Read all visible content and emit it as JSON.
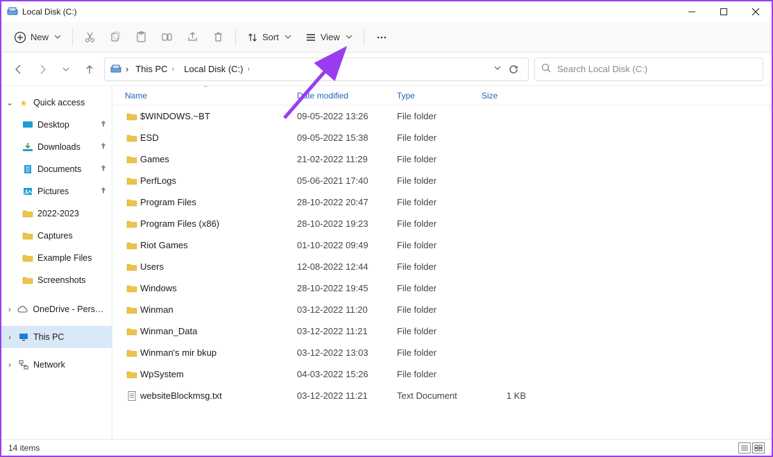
{
  "window": {
    "title": "Local Disk (C:)"
  },
  "toolbar": {
    "new_label": "New",
    "sort_label": "Sort",
    "view_label": "View"
  },
  "breadcrumb": {
    "items": [
      "This PC",
      "Local Disk (C:)"
    ]
  },
  "search": {
    "placeholder": "Search Local Disk (C:)"
  },
  "sidebar": {
    "quick_access": "Quick access",
    "quick_items": [
      {
        "label": "Desktop",
        "pinned": true,
        "icon": "desktop"
      },
      {
        "label": "Downloads",
        "pinned": true,
        "icon": "download"
      },
      {
        "label": "Documents",
        "pinned": true,
        "icon": "document"
      },
      {
        "label": "Pictures",
        "pinned": true,
        "icon": "pictures"
      },
      {
        "label": "2022-2023",
        "pinned": false,
        "icon": "folder"
      },
      {
        "label": "Captures",
        "pinned": false,
        "icon": "folder"
      },
      {
        "label": "Example Files",
        "pinned": false,
        "icon": "folder"
      },
      {
        "label": "Screenshots",
        "pinned": false,
        "icon": "folder"
      }
    ],
    "onedrive": "OneDrive - Personal",
    "this_pc": "This PC",
    "network": "Network"
  },
  "columns": {
    "name": "Name",
    "date": "Date modified",
    "type": "Type",
    "size": "Size"
  },
  "files": [
    {
      "name": "$WINDOWS.~BT",
      "date": "09-05-2022 13:26",
      "type": "File folder",
      "size": "",
      "icon": "folder"
    },
    {
      "name": "ESD",
      "date": "09-05-2022 15:38",
      "type": "File folder",
      "size": "",
      "icon": "folder"
    },
    {
      "name": "Games",
      "date": "21-02-2022 11:29",
      "type": "File folder",
      "size": "",
      "icon": "folder"
    },
    {
      "name": "PerfLogs",
      "date": "05-06-2021 17:40",
      "type": "File folder",
      "size": "",
      "icon": "folder"
    },
    {
      "name": "Program Files",
      "date": "28-10-2022 20:47",
      "type": "File folder",
      "size": "",
      "icon": "folder"
    },
    {
      "name": "Program Files (x86)",
      "date": "28-10-2022 19:23",
      "type": "File folder",
      "size": "",
      "icon": "folder"
    },
    {
      "name": "Riot Games",
      "date": "01-10-2022 09:49",
      "type": "File folder",
      "size": "",
      "icon": "folder"
    },
    {
      "name": "Users",
      "date": "12-08-2022 12:44",
      "type": "File folder",
      "size": "",
      "icon": "folder"
    },
    {
      "name": "Windows",
      "date": "28-10-2022 19:45",
      "type": "File folder",
      "size": "",
      "icon": "folder"
    },
    {
      "name": "Winman",
      "date": "03-12-2022 11:20",
      "type": "File folder",
      "size": "",
      "icon": "folder"
    },
    {
      "name": "Winman_Data",
      "date": "03-12-2022 11:21",
      "type": "File folder",
      "size": "",
      "icon": "folder"
    },
    {
      "name": "Winman's mir bkup",
      "date": "03-12-2022 13:03",
      "type": "File folder",
      "size": "",
      "icon": "folder"
    },
    {
      "name": "WpSystem",
      "date": "04-03-2022 15:26",
      "type": "File folder",
      "size": "",
      "icon": "folder"
    },
    {
      "name": "websiteBlockmsg.txt",
      "date": "03-12-2022 11:21",
      "type": "Text Document",
      "size": "1 KB",
      "icon": "text"
    }
  ],
  "status": {
    "item_count": "14 items"
  }
}
